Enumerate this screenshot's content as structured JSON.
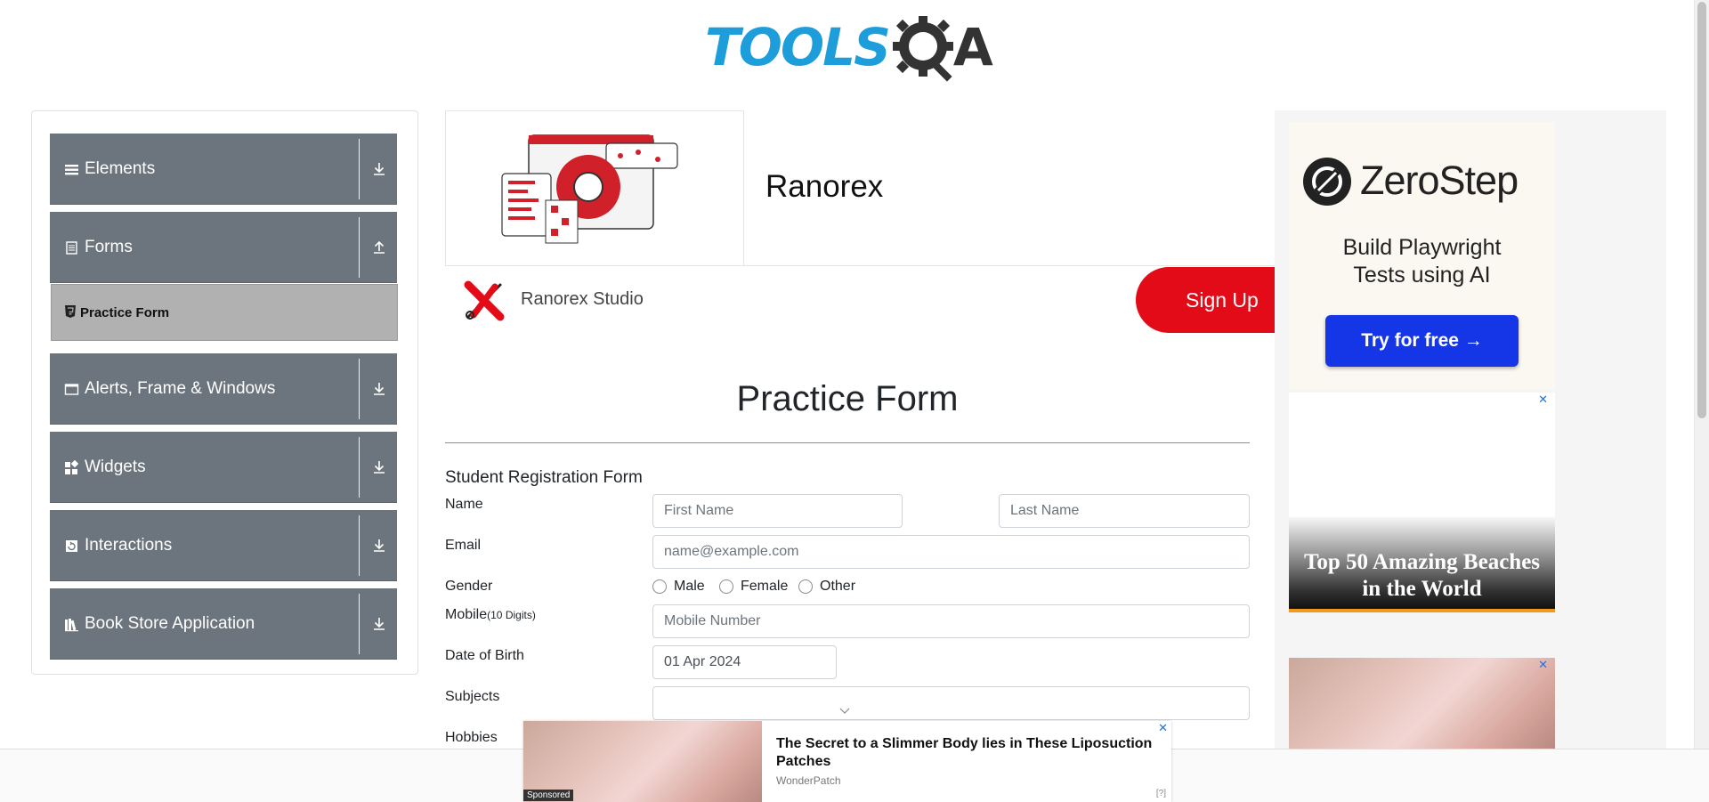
{
  "header": {
    "logo_text": "TOOLS",
    "logo_suffix": "A"
  },
  "sidebar": {
    "groups": [
      {
        "label": "Elements",
        "icon": "menu-icon",
        "arrow": "download-arrow-icon"
      },
      {
        "label": "Forms",
        "icon": "document-icon",
        "arrow": "upload-arrow-icon"
      },
      {
        "label": "Alerts, Frame & Windows",
        "icon": "window-icon",
        "arrow": "download-arrow-icon"
      },
      {
        "label": "Widgets",
        "icon": "widgets-icon",
        "arrow": "download-arrow-icon"
      },
      {
        "label": "Interactions",
        "icon": "interactions-icon",
        "arrow": "download-arrow-icon"
      },
      {
        "label": "Book Store Application",
        "icon": "books-icon",
        "arrow": "download-arrow-icon"
      }
    ],
    "active_item": {
      "label": "Practice Form",
      "icon": "html5-icon"
    }
  },
  "ranorex_ad": {
    "title": "Ranorex",
    "subtitle": "Ranorex Studio",
    "cta": "Sign Up"
  },
  "form": {
    "page_title": "Practice Form",
    "subtitle": "Student Registration Form",
    "labels": {
      "name": "Name",
      "email": "Email",
      "gender": "Gender",
      "mobile": "Mobile",
      "mobile_hint": "(10 Digits)",
      "dob": "Date of Birth",
      "subjects": "Subjects",
      "hobbies": "Hobbies"
    },
    "placeholders": {
      "first_name": "First Name",
      "last_name": "Last Name",
      "email": "name@example.com",
      "mobile": "Mobile Number"
    },
    "gender_options": [
      "Male",
      "Female",
      "Other"
    ],
    "dob_value": "01 Apr 2024",
    "subjects_value": ""
  },
  "right_ads": {
    "zerostep": {
      "brand": "ZeroStep",
      "tagline_1": "Build Playwright",
      "tagline_2": "Tests using AI",
      "cta": "Try for free →",
      "cta_color": "#1436e6"
    },
    "beach": {
      "headline_1": "Top 50 Amazing Beaches",
      "headline_2": "in the World"
    }
  },
  "bottom_ad": {
    "headline": "The Secret to a Slimmer Body lies in These Liposuction Patches",
    "brand": "WonderPatch",
    "sponsored": "Sponsored",
    "adchoice": "[?]"
  },
  "colors": {
    "sidebar_group": "#6c757d",
    "sidebar_active": "#b1b1b1",
    "logo_blue": "#1d9dd9",
    "ranorex_red": "#e30b17"
  }
}
